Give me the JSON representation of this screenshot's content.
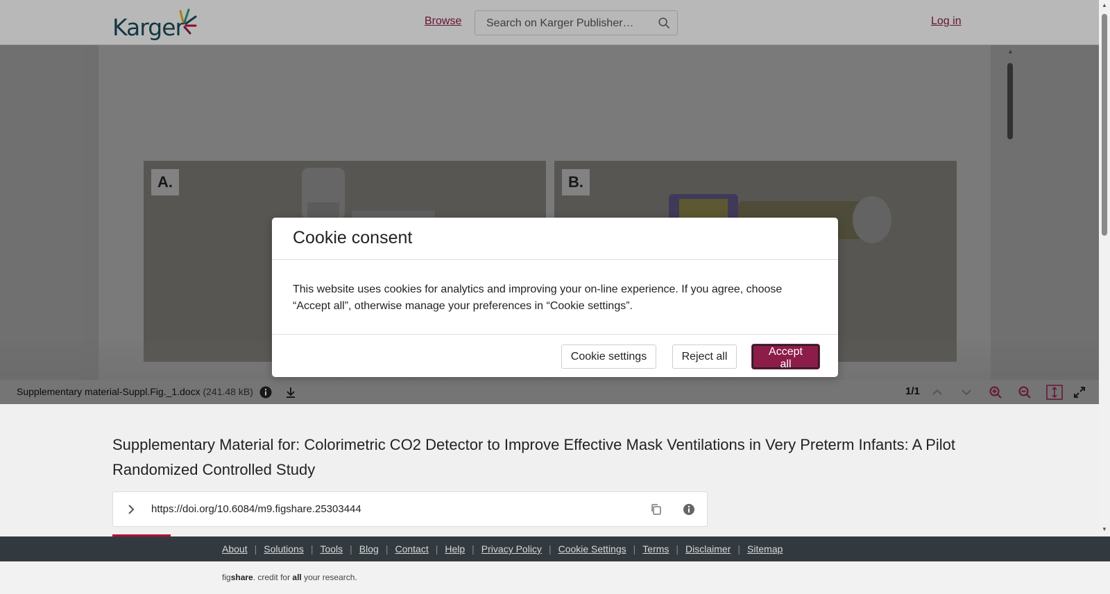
{
  "header": {
    "logo_text": "Karger",
    "browse_label": "Browse",
    "search_placeholder": "Search on Karger Publisher…",
    "login_label": "Log in"
  },
  "viewer": {
    "fig_a_label": "A.",
    "fig_b_label": "B.",
    "file_name": "Supplementary material-Suppl.Fig._1.docx",
    "file_size": "(241.48 kB)",
    "page_indicator": "1/1"
  },
  "cookie_modal": {
    "title": "Cookie consent",
    "body": "This website uses cookies for analytics and improving your on-line experience. If you agree, choose “Accept all”, otherwise manage your preferences in “Cookie settings”.",
    "settings_label": "Cookie settings",
    "reject_label": "Reject all",
    "accept_label": "Accept all",
    "accent_color": "#8c1c4a"
  },
  "article": {
    "title": "Supplementary Material for: Colorimetric CO2 Detector to Improve Effective Mask Ventilations in Very Preterm Infants: A Pilot Randomized Controlled Study",
    "doi": "https://doi.org/10.6084/m9.figshare.25303444"
  },
  "footer": {
    "links": [
      "About",
      "Solutions",
      "Tools",
      "Blog",
      "Contact",
      "Help",
      "Privacy Policy",
      "Cookie Settings",
      "Terms",
      "Disclaimer",
      "Sitemap"
    ],
    "credit_pre": "fig",
    "credit_brand": "share",
    "credit_mid": ". credit for ",
    "credit_all": "all",
    "credit_post": " your research."
  }
}
